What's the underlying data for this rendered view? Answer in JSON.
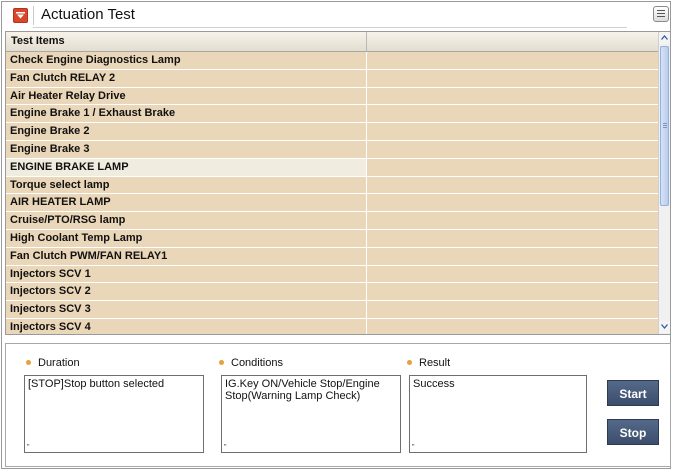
{
  "window": {
    "title": "Actuation Test"
  },
  "table": {
    "columns": [
      "Test Items",
      ""
    ],
    "rows": [
      {
        "item": "Check Engine Diagnostics Lamp",
        "value": ""
      },
      {
        "item": "Fan Clutch RELAY 2",
        "value": ""
      },
      {
        "item": "Air Heater Relay Drive",
        "value": ""
      },
      {
        "item": "Engine Brake 1 / Exhaust Brake",
        "value": ""
      },
      {
        "item": "Engine Brake 2",
        "value": ""
      },
      {
        "item": "Engine Brake 3",
        "value": ""
      },
      {
        "item": "ENGINE BRAKE LAMP",
        "value": "",
        "selected": true
      },
      {
        "item": "Torque select lamp",
        "value": ""
      },
      {
        "item": "AIR HEATER LAMP",
        "value": ""
      },
      {
        "item": "Cruise/PTO/RSG lamp",
        "value": ""
      },
      {
        "item": "High Coolant Temp Lamp",
        "value": ""
      },
      {
        "item": "Fan Clutch PWM/FAN RELAY1",
        "value": ""
      },
      {
        "item": "Injectors SCV 1",
        "value": ""
      },
      {
        "item": "Injectors SCV 2",
        "value": ""
      },
      {
        "item": "Injectors SCV 3",
        "value": ""
      },
      {
        "item": "Injectors SCV 4",
        "value": ""
      }
    ]
  },
  "fields": {
    "duration": {
      "label": "Duration",
      "value": "[STOP]Stop button selected"
    },
    "conditions": {
      "label": "Conditions",
      "value": "IG.Key ON/Vehicle Stop/Engine Stop(Warning Lamp Check)"
    },
    "result": {
      "label": "Result",
      "value": "Success"
    }
  },
  "buttons": {
    "start": "Start",
    "stop": "Stop"
  },
  "icons": {
    "title": "dropdown-arrow-icon",
    "menu": "list-menu-icon",
    "scroll_up": "scroll-up-arrow-icon",
    "scroll_down": "scroll-down-arrow-icon"
  },
  "colors": {
    "row_bg": "#ead6b8",
    "selected_row_bg": "#f1ece0",
    "title_icon": "#d9472b",
    "button_bg": "#45587a",
    "bullet": "#e8a03a"
  }
}
